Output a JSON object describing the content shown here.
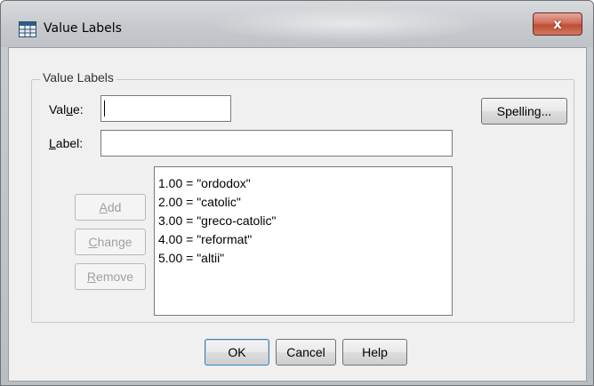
{
  "window": {
    "title": "Value Labels",
    "close_label": "x"
  },
  "group": {
    "legend": "Value Labels"
  },
  "value_field": {
    "label_pre": "Val",
    "label_mnemonic": "u",
    "label_post": "e:",
    "value": ""
  },
  "label_field": {
    "label_mnemonic": "L",
    "label_post": "abel:",
    "value": ""
  },
  "buttons": {
    "spelling": "Spelling...",
    "add_mnemonic": "A",
    "add_rest": "dd",
    "change_mnemonic": "C",
    "change_rest": "hange",
    "remove_mnemonic": "R",
    "remove_rest": "emove",
    "ok": "OK",
    "cancel": "Cancel",
    "help": "Help"
  },
  "value_list": [
    "1.00 = \"ordodox\"",
    "2.00 = \"catolic\"",
    "3.00 = \"greco-catolic\"",
    "4.00 = \"reformat\"",
    "5.00 = \"altii\""
  ],
  "colors": {
    "default_button_border": "#3c7fb1",
    "close_button": "#c04d34"
  },
  "icons": {
    "app": "data-grid-icon",
    "close": "close-icon"
  }
}
